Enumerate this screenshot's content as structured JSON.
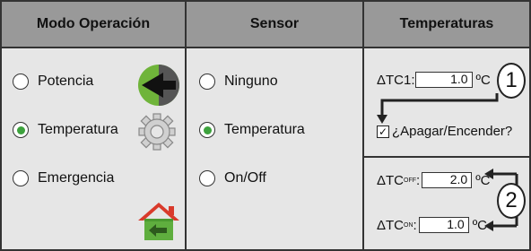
{
  "headers": {
    "mode": "Modo Operación",
    "sensor": "Sensor",
    "temps": "Temperaturas"
  },
  "mode_options": [
    {
      "label": "Potencia",
      "selected": false
    },
    {
      "label": "Temperatura",
      "selected": true
    },
    {
      "label": "Emergencia",
      "selected": false
    }
  ],
  "sensor_options": [
    {
      "label": "Ninguno",
      "selected": false
    },
    {
      "label": "Temperatura",
      "selected": true
    },
    {
      "label": "On/Off",
      "selected": false
    }
  ],
  "temps": {
    "tc1_label": "ΔTC1:",
    "tc1_value": "1.0",
    "unit": "ºC",
    "checkbox_label": "¿Apagar/Encender?",
    "checkbox_checked": true,
    "tc_off_label": "ΔTC",
    "tc_off_sub": "OFF",
    "tc_off_value": "2.0",
    "tc_on_label": "ΔTC",
    "tc_on_sub": "ON",
    "tc_on_value": "1.0"
  },
  "callouts": {
    "one": "1",
    "two": "2"
  },
  "icons": [
    "arrow-left-icon",
    "gear-icon",
    "home-return-icon"
  ],
  "colors": {
    "header_bg": "#999999",
    "panel_bg": "#e6e6e6",
    "accent_green": "#3da23d",
    "house_red": "#d93a2b"
  }
}
